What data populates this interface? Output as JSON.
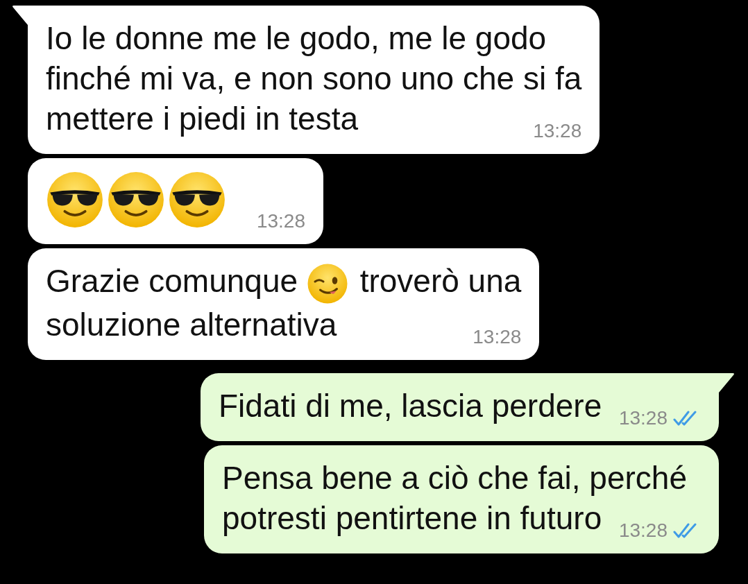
{
  "messages": [
    {
      "outgoing": false,
      "tail": true,
      "lines": [
        [
          {
            "kind": "text",
            "text": "Io le donne me le godo, me le godo"
          }
        ],
        [
          {
            "kind": "text",
            "text": "finché mi va, e non sono uno che si fa"
          }
        ],
        [
          {
            "kind": "text",
            "text": "mettere i piedi in testa"
          }
        ]
      ],
      "time": "13:28"
    },
    {
      "outgoing": false,
      "tail": false,
      "lines": [
        [
          {
            "kind": "cool"
          },
          {
            "kind": "cool"
          },
          {
            "kind": "cool"
          }
        ]
      ],
      "time": "13:28"
    },
    {
      "outgoing": false,
      "tail": false,
      "lines": [
        [
          {
            "kind": "text",
            "text": "Grazie comunque"
          },
          {
            "kind": "wink"
          },
          {
            "kind": "text",
            "text": "troverò una"
          }
        ],
        [
          {
            "kind": "text",
            "text": "soluzione alternativa"
          }
        ]
      ],
      "time": "13:28"
    },
    {
      "outgoing": true,
      "tail": true,
      "lines": [
        [
          {
            "kind": "text",
            "text": "Fidati di me, lascia perdere"
          }
        ]
      ],
      "time": "13:28",
      "read": true
    },
    {
      "outgoing": true,
      "tail": false,
      "lines": [
        [
          {
            "kind": "text",
            "text": "Pensa bene a ciò che fai, perché"
          }
        ],
        [
          {
            "kind": "text",
            "text": "potresti pentirtene in futuro"
          }
        ]
      ],
      "time": "13:28",
      "read": true
    }
  ]
}
